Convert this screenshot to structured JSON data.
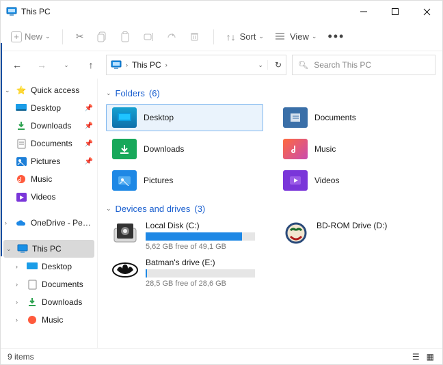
{
  "window": {
    "title": "This PC"
  },
  "toolbar": {
    "new_label": "New",
    "sort_label": "Sort",
    "view_label": "View"
  },
  "nav": {
    "crumb": "This PC",
    "search_placeholder": "Search This PC"
  },
  "sidebar": {
    "quick_access": "Quick access",
    "items": [
      {
        "label": "Desktop"
      },
      {
        "label": "Downloads"
      },
      {
        "label": "Documents"
      },
      {
        "label": "Pictures"
      },
      {
        "label": "Music"
      },
      {
        "label": "Videos"
      }
    ],
    "onedrive": "OneDrive - Perso",
    "this_pc": "This PC",
    "pc_items": [
      {
        "label": "Desktop"
      },
      {
        "label": "Documents"
      },
      {
        "label": "Downloads"
      },
      {
        "label": "Music"
      }
    ]
  },
  "sections": {
    "folders": {
      "label": "Folders",
      "count": "(6)"
    },
    "drives": {
      "label": "Devices and drives",
      "count": "(3)"
    }
  },
  "folders": [
    {
      "name": "Desktop"
    },
    {
      "name": "Documents"
    },
    {
      "name": "Downloads"
    },
    {
      "name": "Music"
    },
    {
      "name": "Pictures"
    },
    {
      "name": "Videos"
    }
  ],
  "drives": [
    {
      "name": "Local Disk (C:)",
      "free": "5,62 GB free of 49,1 GB",
      "fill_pct": 88
    },
    {
      "name": "BD-ROM Drive (D:)"
    },
    {
      "name": "Batman's drive (E:)",
      "free": "28,5 GB free of 28,6 GB",
      "fill_pct": 0.4
    }
  ],
  "status": {
    "items_text": "9 items"
  }
}
